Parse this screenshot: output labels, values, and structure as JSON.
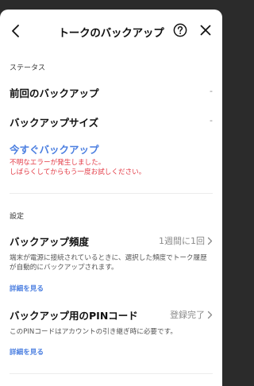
{
  "header": {
    "title": "トークのバックアップ",
    "back_icon": "chevron-left-icon",
    "help_icon": "question-circle-icon",
    "close_icon": "close-icon"
  },
  "status_section": {
    "label": "ステータス",
    "last_backup": {
      "label": "前回のバックアップ",
      "value": "-"
    },
    "backup_size": {
      "label": "バックアップサイズ",
      "value": "-"
    },
    "backup_now_label": "今すぐバックアップ",
    "error_line1": "不明なエラーが発生しました。",
    "error_line2": "しばらくしてからもう一度お試しください。"
  },
  "settings_section": {
    "label": "設定",
    "frequency": {
      "label": "バックアップ頻度",
      "value": "1週間に1回",
      "description": "端末が電源に接続されているときに、選択した頻度でトーク履歴が自動的にバックアップされます。",
      "details_label": "詳細を見る"
    },
    "pin": {
      "label": "バックアップ用のPINコード",
      "value": "登録完了",
      "description": "このPINコードはアカウントの引き継ぎ時に必要です。",
      "details_label": "詳細を見る"
    }
  },
  "colors": {
    "accent_blue": "#4a7ee0",
    "error_red": "#e33a45",
    "muted_gray": "#8a8a8a"
  }
}
